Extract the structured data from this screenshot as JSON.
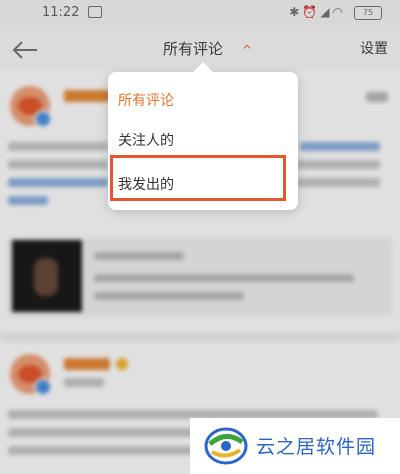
{
  "status_bar": {
    "time": "11:22",
    "icons": [
      "nfc-icon",
      "alarm-icon",
      "signal-icon",
      "wifi-icon",
      "battery-icon"
    ],
    "battery": "75"
  },
  "navbar": {
    "title": "所有评论",
    "settings_label": "设置"
  },
  "dropdown": {
    "items": [
      {
        "label": "所有评论",
        "selected": true
      },
      {
        "label": "关注人的",
        "selected": false
      },
      {
        "label": "我发出的",
        "selected": false,
        "highlighted": true
      }
    ]
  },
  "watermark": {
    "text": "云之居软件园"
  },
  "colors": {
    "accent": "#e8732a",
    "highlight": "#e8562e",
    "watermark_blue": "#2a66c9"
  }
}
